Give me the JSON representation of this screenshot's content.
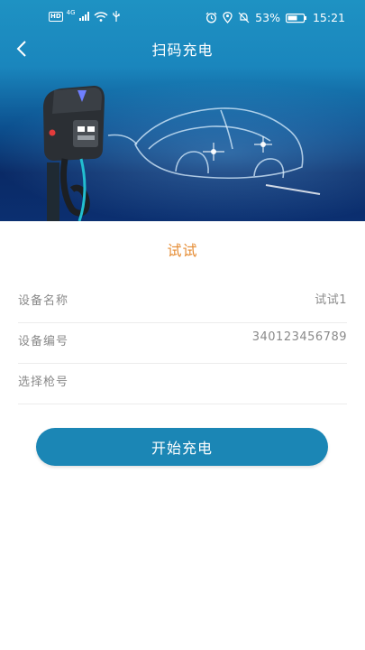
{
  "status_bar": {
    "hd": "HD",
    "network": "4G",
    "battery": "53%",
    "time": "15:21"
  },
  "header": {
    "title": "扫码充电",
    "back_icon": "back-chevron-icon"
  },
  "device": {
    "title": "试试",
    "fields": [
      {
        "label": "设备名称",
        "value": "试试1"
      },
      {
        "label": "设备编号",
        "value": "340123456789"
      },
      {
        "label": "选择枪号",
        "value": ""
      }
    ]
  },
  "actions": {
    "start_label": "开始充电"
  },
  "colors": {
    "accent": "#1b86b5",
    "title_orange": "#e58b32",
    "label_gray": "#8a8a8a"
  }
}
